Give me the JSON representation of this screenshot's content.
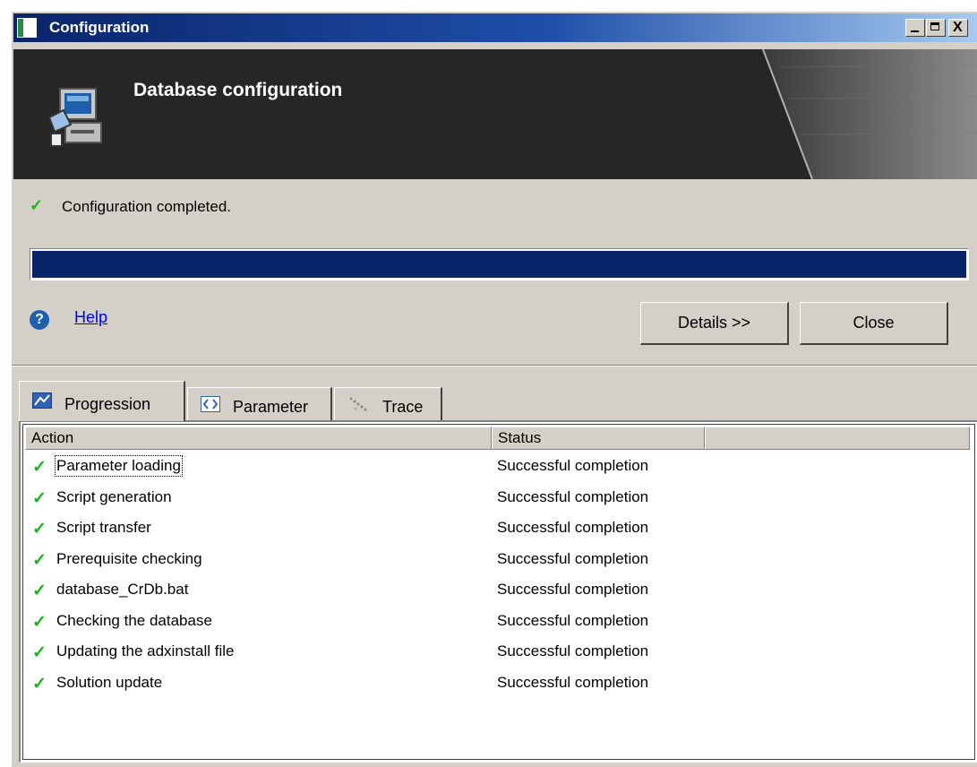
{
  "window": {
    "title": "Configuration",
    "controls": {
      "minimize_icon": "minimize-icon",
      "maximize_icon": "maximize-icon",
      "close_label": "X"
    }
  },
  "banner": {
    "title": "Database configuration",
    "icon": "computer-setup-icon"
  },
  "status": {
    "icon": "check-icon",
    "text": "Configuration completed."
  },
  "progress": {
    "fraction": 1.0,
    "color": "#0a246a"
  },
  "help": {
    "icon": "help-icon",
    "label": "Help"
  },
  "buttons": {
    "details": "Details >>",
    "close": "Close"
  },
  "tabs": [
    {
      "label": "Progression",
      "icon": "progression-icon",
      "active": true
    },
    {
      "label": "Parameter",
      "icon": "parameter-icon",
      "active": false
    },
    {
      "label": "Trace",
      "icon": "trace-icon",
      "active": false
    }
  ],
  "table": {
    "columns": [
      "Action",
      "Status"
    ],
    "rows": [
      {
        "action": "Parameter loading",
        "status": "Successful completion"
      },
      {
        "action": "Script generation",
        "status": "Successful completion"
      },
      {
        "action": "Script transfer",
        "status": "Successful completion"
      },
      {
        "action": "Prerequisite checking",
        "status": "Successful completion"
      },
      {
        "action": "database_CrDb.bat",
        "status": "Successful completion"
      },
      {
        "action": "Checking the database",
        "status": "Successful completion"
      },
      {
        "action": "Updating the adxinstall file",
        "status": "Successful completion"
      },
      {
        "action": "Solution update",
        "status": "Successful completion"
      }
    ]
  },
  "colors": {
    "success": "#1bb31b",
    "titlebar": "#0a246a",
    "link": "#0000ee"
  }
}
